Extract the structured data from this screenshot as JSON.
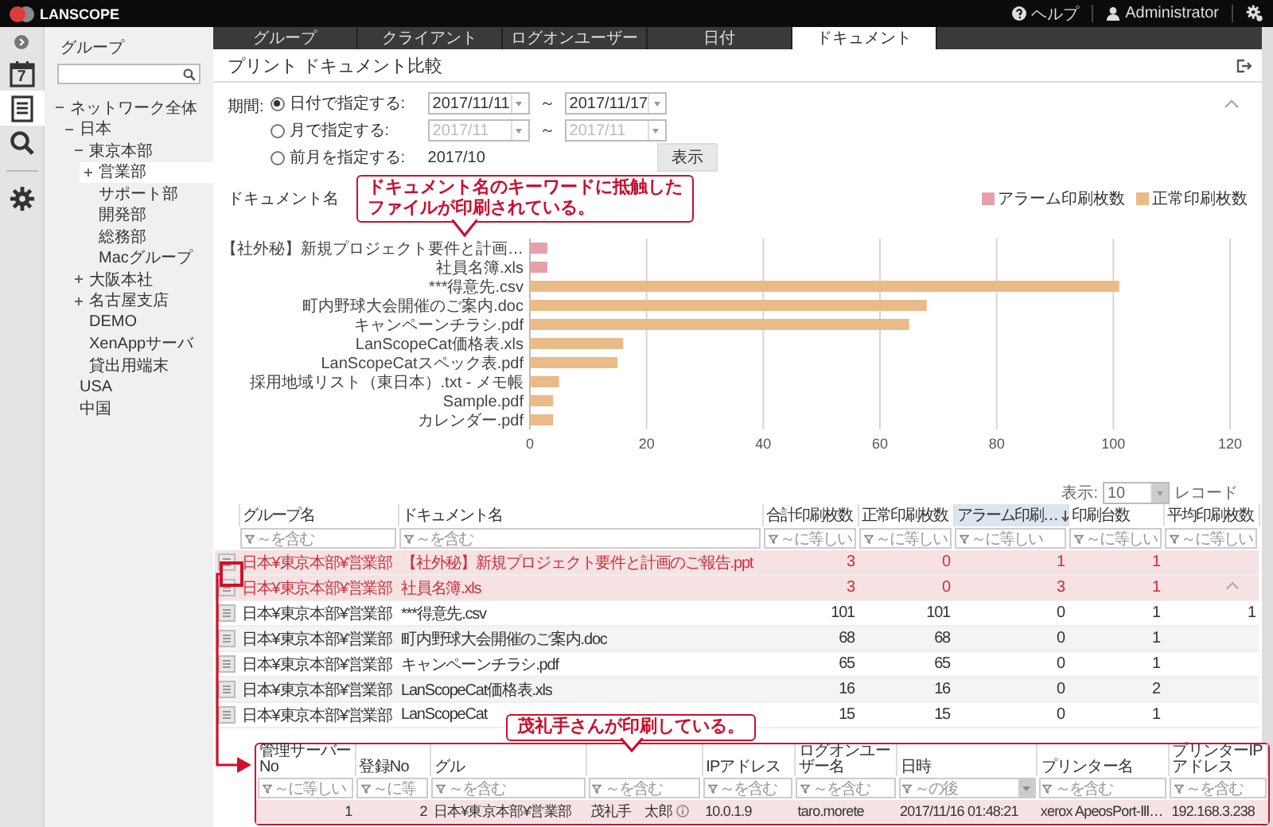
{
  "app": {
    "logo": "LANSCOPE",
    "help": "ヘルプ",
    "user": "Administrator"
  },
  "rail": [
    {
      "kind": "calendar",
      "label": "7",
      "selected": false
    },
    {
      "kind": "document",
      "selected": true
    },
    {
      "kind": "search",
      "selected": false
    },
    {
      "kind": "settings",
      "selected": false
    }
  ],
  "tabs": [
    {
      "label": "グループ",
      "selected": false
    },
    {
      "label": "クライアント",
      "selected": false
    },
    {
      "label": "ログオンユーザー",
      "selected": false
    },
    {
      "label": "日付",
      "selected": false
    },
    {
      "label": "ドキュメント",
      "selected": true
    }
  ],
  "sidebar": {
    "title": "グループ",
    "tree": [
      {
        "label": "ネットワーク全体",
        "expanded": true,
        "selected": false,
        "children": [
          {
            "label": "日本",
            "expanded": true,
            "selected": false,
            "children": [
              {
                "label": "東京本部",
                "expanded": true,
                "selected": false,
                "children": [
                  {
                    "label": "営業部",
                    "expanded": false,
                    "selected": true
                  },
                  {
                    "label": "サポート部",
                    "selected": false
                  },
                  {
                    "label": "開発部",
                    "selected": false
                  },
                  {
                    "label": "総務部",
                    "selected": false
                  },
                  {
                    "label": "Macグループ",
                    "selected": false
                  }
                ]
              },
              {
                "label": "大阪本社",
                "expanded": false,
                "selected": false
              },
              {
                "label": "名古屋支店",
                "expanded": false,
                "selected": false
              },
              {
                "label": "DEMO",
                "selected": false
              },
              {
                "label": "XenAppサーバ",
                "selected": false
              },
              {
                "label": "貸出用端末",
                "selected": false
              }
            ]
          },
          {
            "label": "USA",
            "selected": false
          },
          {
            "label": "中国",
            "selected": false
          }
        ]
      }
    ]
  },
  "page": {
    "title": "プリント ドキュメント比較"
  },
  "period": {
    "label": "期間:",
    "button": "表示",
    "options": [
      {
        "kind": "range",
        "label": "日付で指定する:",
        "selected": true,
        "disabled": false,
        "from": "2017/11/11",
        "separator": "～",
        "to": "2017/11/17"
      },
      {
        "kind": "range",
        "label": "月で指定する:",
        "selected": false,
        "disabled": true,
        "from": "2017/11",
        "separator": "～",
        "to": "2017/11"
      },
      {
        "kind": "value",
        "label": "前月を指定する:",
        "selected": false,
        "value": "2017/10"
      }
    ]
  },
  "chart": {
    "label": "ドキュメント名",
    "callout": [
      "ドキュメント名のキーワードに抵触した",
      "ファイルが印刷されている。"
    ],
    "chart_data": {
      "type": "bar",
      "orientation": "horizontal",
      "stacked": true,
      "grid": true,
      "categories": [
        "【社外秘】新規プロジェクト要件と計画…",
        "社員名簿.xls",
        "***得意先.csv",
        "町内野球大会開催のご案内.doc",
        "キャンペーンチラシ.pdf",
        "LanScopeCat価格表.xls",
        "LanScopeCatスペック表.pdf",
        "採用地域リスト（東日本）.txt - メモ帳",
        "Sample.pdf",
        "カレンダー.pdf"
      ],
      "series": [
        {
          "name": "アラーム印刷枚数",
          "color": "#e8a0a8",
          "values": [
            3,
            3,
            null,
            null,
            null,
            null,
            null,
            null,
            null,
            null
          ]
        },
        {
          "name": "正常印刷枚数",
          "color": "#e9bb88",
          "values": [
            null,
            null,
            101,
            68,
            65,
            16,
            15,
            5,
            4,
            4
          ]
        }
      ],
      "xlim": [
        0,
        120
      ],
      "xticks": [
        0,
        20,
        40,
        60,
        80,
        100,
        120
      ]
    }
  },
  "table": {
    "page_size_label": "表示:",
    "page_size": "10",
    "page_size_unit": "レコード",
    "columns": [
      {
        "label": "グループ名",
        "sorted": false,
        "kind": "text",
        "filter": {
          "placeholder": "～を含む"
        }
      },
      {
        "label": "ドキュメント名",
        "sorted": false,
        "kind": "text",
        "filter": {
          "placeholder": "～を含む"
        }
      },
      {
        "label": "合計印刷枚数",
        "sorted": false,
        "kind": "number",
        "filter": {
          "placeholder": "～に等しい"
        }
      },
      {
        "label": "正常印刷枚数",
        "sorted": false,
        "kind": "number",
        "filter": {
          "placeholder": "～に等しい"
        }
      },
      {
        "label": "アラーム印刷…",
        "sorted": true,
        "kind": "number",
        "filter": {
          "placeholder": "～に等しい"
        }
      },
      {
        "label": "印刷台数",
        "sorted": false,
        "kind": "number",
        "filter": {
          "placeholder": "～に等しい"
        }
      },
      {
        "label": "平均印刷枚数",
        "sorted": false,
        "kind": "number",
        "filter": {
          "placeholder": "～に等しい"
        }
      }
    ],
    "rows": [
      {
        "alarm": true,
        "cells": [
          "日本¥東京本部¥営業部",
          "【社外秘】新規プロジェクト要件と計画のご報告.ppt",
          "3",
          "0",
          "1",
          "1"
        ]
      },
      {
        "alarm": true,
        "cells": [
          "日本¥東京本部¥営業部",
          "社員名簿.xls",
          "3",
          "0",
          "3",
          "1"
        ]
      },
      {
        "alarm": false,
        "cells": [
          "日本¥東京本部¥営業部",
          "***得意先.csv",
          "101",
          "101",
          "0",
          "1",
          "1"
        ]
      },
      {
        "alarm": false,
        "cells": [
          "日本¥東京本部¥営業部",
          "町内野球大会開催のご案内.doc",
          "68",
          "68",
          "0",
          "1"
        ]
      },
      {
        "alarm": false,
        "cells": [
          "日本¥東京本部¥営業部",
          "キャンペーンチラシ.pdf",
          "65",
          "65",
          "0",
          "1"
        ]
      },
      {
        "alarm": false,
        "cells": [
          "日本¥東京本部¥営業部",
          "LanScopeCat価格表.xls",
          "16",
          "16",
          "0",
          "2"
        ]
      },
      {
        "alarm": false,
        "cells": [
          "日本¥東京本部¥営業部",
          "LanScopeCat",
          "15",
          "15",
          "0",
          "1"
        ]
      }
    ]
  },
  "detail": {
    "callout": "茂礼手さんが印刷している。",
    "columns": [
      {
        "label": "管理サーバーNo",
        "kind": "number",
        "filter": {
          "placeholder": "～に等しい",
          "kind": "text"
        }
      },
      {
        "label": "登録No",
        "kind": "number",
        "filter": {
          "placeholder": "～に等",
          "kind": "text"
        }
      },
      {
        "label": "グル",
        "kind": "text",
        "filter": {
          "placeholder": "～を含む",
          "kind": "text"
        }
      },
      {
        "kind": "user",
        "filter": {
          "placeholder": "～を含む",
          "kind": "text"
        }
      },
      {
        "label": "IPアドレス",
        "kind": "text",
        "filter": {
          "placeholder": "～を含む",
          "kind": "text"
        }
      },
      {
        "label": "ログオンユーザー名",
        "kind": "text",
        "filter": {
          "placeholder": "～を含む",
          "kind": "text"
        }
      },
      {
        "label": "日時",
        "kind": "text",
        "filter": {
          "placeholder": "～の後",
          "kind": "select"
        }
      },
      {
        "label": "プリンター名",
        "kind": "text",
        "filter": {
          "placeholder": "～を含む",
          "kind": "text"
        }
      },
      {
        "label": "プリンターIPアドレス",
        "kind": "text",
        "filter": {
          "placeholder": "～を含む",
          "kind": "text"
        }
      }
    ],
    "rows": [
      {
        "selected": true,
        "cells": [
          "1",
          "2",
          "日本¥東京本部¥営業部",
          "茂礼手　太郎",
          "10.0.1.9",
          "taro.morete",
          "2017/11/16 01:48:21",
          "xerox ApeosPort-Ⅲ…",
          "192.168.3.238"
        ]
      }
    ]
  }
}
